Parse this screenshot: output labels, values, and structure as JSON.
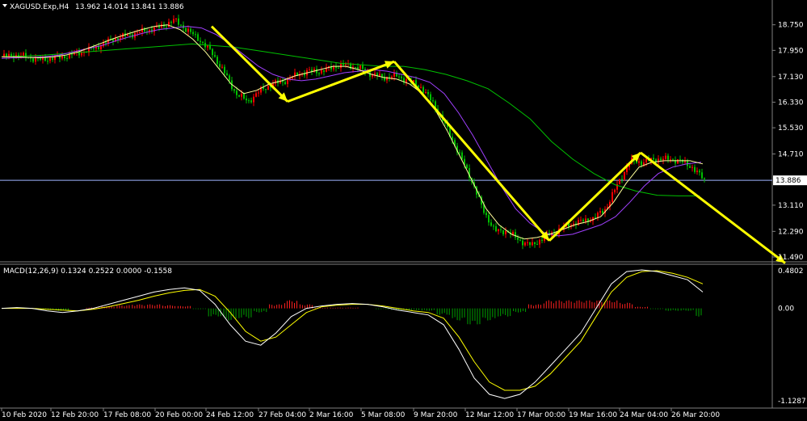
{
  "header": {
    "symbol_title": "XAGUSD.Exp,H4",
    "ohlc": "13.962 14.014 13.841 13.886",
    "menu_icon": "triangle-down-icon"
  },
  "macd_header": {
    "title": "MACD(12,26,9) 0.1324 0.2522 0.0000 -0.1558"
  },
  "colors": {
    "background": "#000000",
    "bull_candle": "#ff0000",
    "bear_candle": "#00c000",
    "price_line": "#a0b4ff",
    "ma_fast": "#ffff99",
    "ma_mid": "#a040ff",
    "ma_slow": "#00c000",
    "arrows": "#ffff00",
    "macd_line": "#ffffff",
    "signal_line": "#ffff00",
    "hist_pos": "#ff2020",
    "hist_neg": "#00a000",
    "grid_text": "#ffffff"
  },
  "chart_data": [
    {
      "type": "candlestick",
      "title": "XAGUSD.Exp,H4",
      "ylim": [
        11.49,
        19.07
      ],
      "y_ticks": [
        "18.750",
        "17.950",
        "17.130",
        "16.330",
        "15.530",
        "14.710",
        "13.110",
        "12.290",
        "11.490"
      ],
      "current_price_label": "13.886",
      "current_price": 13.886,
      "x_ticks": [
        "10 Feb 2020",
        "12 Feb 20:00",
        "17 Feb 08:00",
        "20 Feb 00:00",
        "24 Feb 12:00",
        "27 Feb 04:00",
        "2 Mar 16:00",
        "5 Mar 08:00",
        "9 Mar 20:00",
        "12 Mar 12:00",
        "17 Mar 00:00",
        "19 Mar 16:00",
        "24 Mar 04:00",
        "26 Mar 20:00"
      ],
      "price_path": [
        17.75,
        17.8,
        17.75,
        17.65,
        17.7,
        17.75,
        17.85,
        17.95,
        18.1,
        18.3,
        18.4,
        18.5,
        18.6,
        18.7,
        18.9,
        18.6,
        18.3,
        17.9,
        17.3,
        16.6,
        16.35,
        16.7,
        16.9,
        17.0,
        17.2,
        17.3,
        17.3,
        17.45,
        17.5,
        17.4,
        17.2,
        17.1,
        17.15,
        17.0,
        16.8,
        16.3,
        15.6,
        14.8,
        14.0,
        13.0,
        12.3,
        12.3,
        12.0,
        11.85,
        12.1,
        12.3,
        12.5,
        12.6,
        12.7,
        13.0,
        13.8,
        14.5,
        14.45,
        14.55,
        14.55,
        14.5,
        14.3,
        13.9
      ],
      "ma_fast": [
        17.75,
        17.75,
        17.73,
        17.72,
        17.74,
        17.8,
        17.9,
        18.05,
        18.2,
        18.35,
        18.48,
        18.6,
        18.7,
        18.75,
        18.6,
        18.3,
        17.9,
        17.4,
        16.9,
        16.6,
        16.7,
        16.9,
        17.0,
        17.15,
        17.25,
        17.35,
        17.45,
        17.45,
        17.35,
        17.2,
        17.1,
        17.05,
        16.9,
        16.6,
        16.1,
        15.4,
        14.6,
        13.8,
        13.0,
        12.5,
        12.2,
        12.05,
        12.1,
        12.2,
        12.35,
        12.5,
        12.6,
        12.75,
        13.2,
        13.8,
        14.3,
        14.45,
        14.5,
        14.5,
        14.5,
        14.4
      ],
      "ma_mid": [
        17.7,
        17.72,
        17.73,
        17.75,
        17.8,
        17.9,
        18.0,
        18.1,
        18.25,
        18.38,
        18.5,
        18.6,
        18.65,
        18.7,
        18.65,
        18.45,
        18.15,
        17.8,
        17.45,
        17.2,
        17.05,
        17.0,
        17.05,
        17.15,
        17.25,
        17.3,
        17.35,
        17.3,
        17.2,
        17.1,
        16.95,
        16.6,
        16.0,
        15.3,
        14.5,
        13.7,
        13.0,
        12.55,
        12.25,
        12.15,
        12.2,
        12.35,
        12.5,
        12.75,
        13.2,
        13.7,
        14.1,
        14.3,
        14.4,
        14.45
      ],
      "ma_slow": [
        17.75,
        17.77,
        17.8,
        17.85,
        17.9,
        17.95,
        18.0,
        18.05,
        18.1,
        18.15,
        18.1,
        18.05,
        17.95,
        17.85,
        17.75,
        17.65,
        17.55,
        17.5,
        17.45,
        17.45,
        17.35,
        17.2,
        17.0,
        16.75,
        16.3,
        15.8,
        15.1,
        14.55,
        14.1,
        13.75,
        13.55,
        13.42,
        13.4,
        13.4
      ],
      "arrows": [
        {
          "from": 18.7,
          "to": 16.35
        },
        {
          "from": 16.35,
          "to": 17.6
        },
        {
          "from": 17.6,
          "to": 12.0
        },
        {
          "from": 12.0,
          "to": 14.75
        },
        {
          "from": 14.75,
          "to": 11.3
        }
      ]
    },
    {
      "type": "macd",
      "title": "MACD(12,26,9) 0.1324 0.2522 0.0000 -0.1558",
      "ylim": [
        -1.1287,
        0.4802
      ],
      "y_ticks": [
        "0.4802",
        "0.00",
        "-1.1287"
      ],
      "macd": [
        0.0,
        0.01,
        0.0,
        -0.03,
        -0.05,
        -0.03,
        0.0,
        0.05,
        0.1,
        0.15,
        0.2,
        0.23,
        0.25,
        0.22,
        0.05,
        -0.2,
        -0.4,
        -0.45,
        -0.3,
        -0.1,
        0.0,
        0.03,
        0.05,
        0.06,
        0.05,
        0.02,
        -0.02,
        -0.05,
        -0.08,
        -0.2,
        -0.5,
        -0.85,
        -1.05,
        -1.1,
        -1.05,
        -0.9,
        -0.7,
        -0.5,
        -0.3,
        0.0,
        0.3,
        0.45,
        0.47,
        0.45,
        0.4,
        0.35,
        0.2
      ],
      "signal": [
        0.0,
        0.0,
        0.0,
        -0.01,
        -0.02,
        -0.03,
        -0.01,
        0.02,
        0.06,
        0.1,
        0.15,
        0.19,
        0.22,
        0.23,
        0.15,
        -0.05,
        -0.28,
        -0.4,
        -0.35,
        -0.2,
        -0.05,
        0.02,
        0.04,
        0.05,
        0.05,
        0.03,
        0.0,
        -0.03,
        -0.05,
        -0.12,
        -0.35,
        -0.65,
        -0.9,
        -1.0,
        -1.0,
        -0.95,
        -0.8,
        -0.6,
        -0.4,
        -0.1,
        0.2,
        0.38,
        0.45,
        0.46,
        0.43,
        0.38,
        0.3
      ],
      "histogram": [
        0.0,
        0.01,
        0.0,
        -0.02,
        -0.03,
        0.0,
        0.01,
        0.03,
        0.04,
        0.05,
        0.05,
        0.04,
        0.03,
        -0.01,
        -0.1,
        -0.15,
        -0.12,
        -0.05,
        0.05,
        0.1,
        0.05,
        0.01,
        0.01,
        0.01,
        0.0,
        -0.01,
        -0.02,
        -0.02,
        -0.03,
        -0.08,
        -0.15,
        -0.2,
        -0.15,
        -0.1,
        -0.05,
        0.05,
        0.1,
        0.1,
        0.1,
        0.1,
        0.1,
        0.07,
        0.02,
        -0.01,
        -0.03,
        -0.03,
        -0.1
      ]
    }
  ]
}
